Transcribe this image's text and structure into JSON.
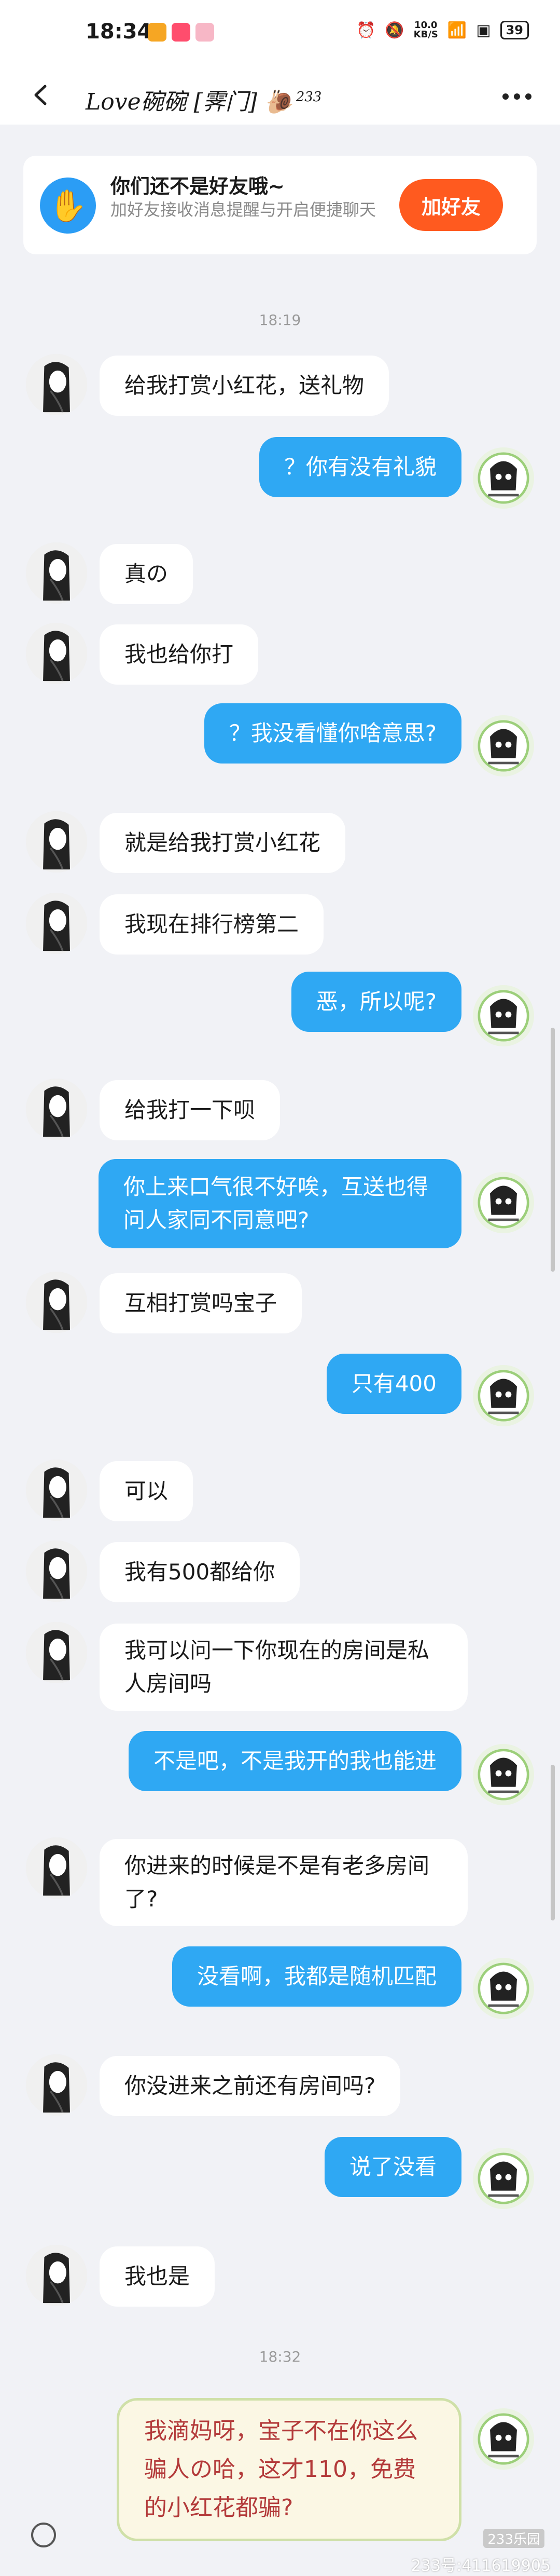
{
  "status_bar": {
    "time": "18:34",
    "speed_top": "10.0",
    "speed_unit": "KB/S",
    "battery": "39"
  },
  "header": {
    "title": "Love碗碗 [霁门]",
    "badge": "233"
  },
  "banner": {
    "title": "你们还不是好友哦~",
    "subtitle": "加好友接收消息提醒与开启便捷聊天",
    "button": "加好友"
  },
  "times": [
    "18:19",
    "18:32"
  ],
  "messages": [
    {
      "side": "in",
      "text": "给我打赏小红花，送礼物"
    },
    {
      "side": "out",
      "text": "？你有没有礼貌"
    },
    {
      "side": "in",
      "text": "真の"
    },
    {
      "side": "in",
      "text": "我也给你打"
    },
    {
      "side": "out",
      "text": "？我没看懂你啥意思?"
    },
    {
      "side": "in",
      "text": "就是给我打赏小红花"
    },
    {
      "side": "in",
      "text": "我现在排行榜第二"
    },
    {
      "side": "out",
      "text": "恶，所以呢?"
    },
    {
      "side": "in",
      "text": "给我打一下呗"
    },
    {
      "side": "out",
      "text": "你上来口气很不好唉，互送也得问人家同不同意吧?"
    },
    {
      "side": "in",
      "text": "互相打赏吗宝子"
    },
    {
      "side": "out",
      "text": "只有400"
    },
    {
      "side": "in",
      "text": "可以"
    },
    {
      "side": "in",
      "text": "我有500都给你"
    },
    {
      "side": "in",
      "text": "我可以问一下你现在的房间是私人房间吗"
    },
    {
      "side": "out",
      "text": "不是吧，不是我开的我也能进"
    },
    {
      "side": "in",
      "text": "你进来的时候是不是有老多房间了?"
    },
    {
      "side": "out",
      "text": "没看啊，我都是随机匹配"
    },
    {
      "side": "in",
      "text": "你没进来之前还有房间吗?"
    },
    {
      "side": "out",
      "text": "说了没看"
    },
    {
      "side": "in",
      "text": "我也是"
    },
    {
      "side": "out",
      "text": "我滴妈呀，宝子不在你这么骗人の哈，这才110，免费的小红花都骗?"
    }
  ],
  "watermark": "233号:411619905",
  "watermark_logo": "233乐园"
}
